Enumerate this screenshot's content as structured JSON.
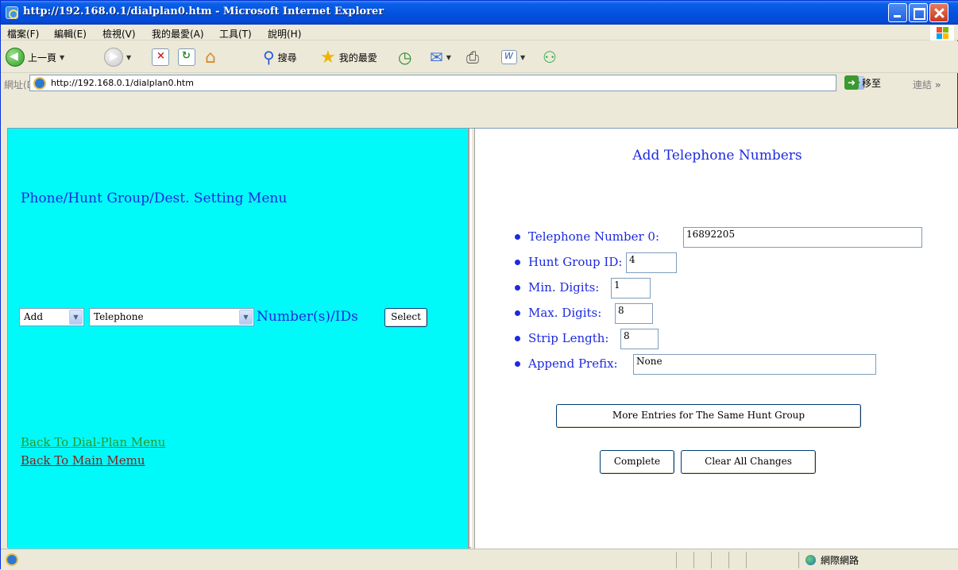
{
  "window": {
    "title": "http://192.168.0.1/dialplan0.htm - Microsoft Internet Explorer"
  },
  "menubar": {
    "items": [
      "檔案(F)",
      "編輯(E)",
      "檢視(V)",
      "我的最愛(A)",
      "工具(T)",
      "說明(H)"
    ]
  },
  "toolbar": {
    "back_label": "上一頁",
    "search_label": "搜尋",
    "favorites_label": "我的最愛"
  },
  "address": {
    "label": "網址(D)",
    "url": "http://192.168.0.1/dialplan0.htm",
    "go_label": "移至",
    "links_label": "連結"
  },
  "left": {
    "menu_title": "Phone/Hunt Group/Dest. Setting Menu",
    "action_select": "Add",
    "type_select": "Telephone",
    "numbers_label": "Number(s)/IDs",
    "select_button": "Select",
    "link_dialplan": "Back To Dial-Plan Menu",
    "link_main": "Back To Main Memu",
    "colors": {
      "background": "#00fafa",
      "text": "#1d2ae0",
      "link_green": "#2a9a2a",
      "link_brown": "#8b1a1a"
    }
  },
  "right": {
    "title": "Add Telephone Numbers",
    "fields": [
      {
        "label": "Telephone Number 0:",
        "value": "16892205"
      },
      {
        "label": "Hunt Group ID:",
        "value": "4"
      },
      {
        "label": "Min. Digits:",
        "value": "1"
      },
      {
        "label": "Max. Digits:",
        "value": "8"
      },
      {
        "label": "Strip Length:",
        "value": "8"
      },
      {
        "label": "Append Prefix:",
        "value": "None"
      }
    ],
    "more_button": "More Entries for The Same Hunt Group",
    "complete_button": "Complete",
    "clear_button": "Clear All Changes"
  },
  "status": {
    "zone": "網際網路"
  }
}
